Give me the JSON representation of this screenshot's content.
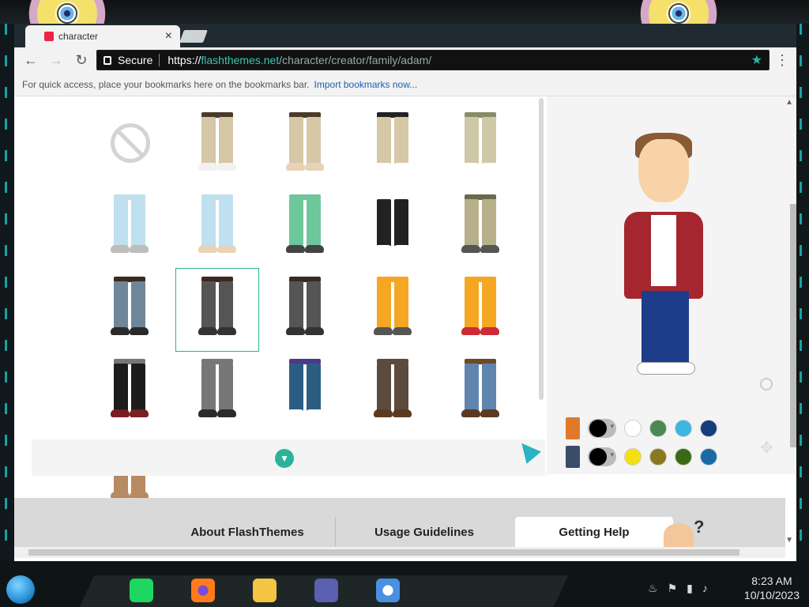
{
  "browser": {
    "tab_title": "character",
    "address": {
      "secure_label": "Secure",
      "scheme": "https://",
      "host": "flashthemes.net",
      "path": "/character/creator/family/adam/"
    },
    "bookmarks_text": "For quick access, place your bookmarks here on the bookmarks bar.",
    "import_link": "Import bookmarks now..."
  },
  "creator": {
    "items": [
      {
        "kind": "none"
      },
      {
        "pants": "#d6c7a6",
        "belt": "#4a3a2a",
        "shoe": "#f2f2f2"
      },
      {
        "pants": "#d6c7a6",
        "belt": "#4a3a2a",
        "shoe": "#e8d3b8"
      },
      {
        "pants": "#d6c7a6",
        "belt": "#222222",
        "shoe": "#ffffff"
      },
      {
        "pants": "#cfc8a8",
        "belt": "#8a8a6a",
        "shoe": "#ffffff"
      },
      {
        "pants": "#bfe0ee",
        "belt": "#bfe0ee",
        "shoe": "#bdbdbd"
      },
      {
        "pants": "#bfe0ee",
        "belt": "#bfe0ee",
        "shoe": "#e8d3b8"
      },
      {
        "pants": "#6cc79b",
        "belt": "#6cc79b",
        "shoe": "#444444"
      },
      {
        "pants": "#222222",
        "belt": "#ffffff",
        "shoe": "#ffffff"
      },
      {
        "pants": "#b7b08a",
        "belt": "#6a6a4a",
        "shoe": "#555555"
      },
      {
        "pants": "#6f8698",
        "belt": "#3a2a20",
        "shoe": "#2a2a2a"
      },
      {
        "pants": "#555555",
        "belt": "#3a2a20",
        "shoe": "#333333",
        "selected": true
      },
      {
        "pants": "#555555",
        "belt": "#3a2a20",
        "shoe": "#333333"
      },
      {
        "pants": "#f5a623",
        "belt": "#f5a623",
        "shoe": "#555555"
      },
      {
        "pants": "#f5a623",
        "belt": "#f5a623",
        "shoe": "#cc2b36"
      },
      {
        "pants": "#1c1c1c",
        "belt": "#777777",
        "shoe": "#7a1e22"
      },
      {
        "pants": "#777777",
        "belt": "#777777",
        "shoe": "#2b2b2b"
      },
      {
        "pants": "#2b5d82",
        "belt": "#4a3a8a",
        "shoe": "#ffffff"
      },
      {
        "pants": "#5c4a3c",
        "belt": "#5c4a3c",
        "shoe": "#5a3a20"
      },
      {
        "pants": "#5f85ad",
        "belt": "#6a4a2a",
        "shoe": "#5a3a20"
      },
      {
        "pants": "#b78a62",
        "belt": "#b78a62",
        "shoe": "#b78a62"
      }
    ],
    "color_rows": [
      {
        "part_color": "#e07a2a",
        "swatches": [
          "#ffffff",
          "#4a8a52",
          "#3cb6e0",
          "#143e7e"
        ]
      },
      {
        "part_color": "#3a4c6a",
        "swatches": [
          "#f3e012",
          "#8a7820",
          "#3a6a16",
          "#1a6aa6"
        ]
      }
    ]
  },
  "footer": {
    "about": "About FlashThemes",
    "guidelines": "Usage Guidelines",
    "help": "Getting Help",
    "help_mark": "?"
  },
  "taskbar": {
    "time": "8:23 AM",
    "date": "10/10/2023"
  }
}
